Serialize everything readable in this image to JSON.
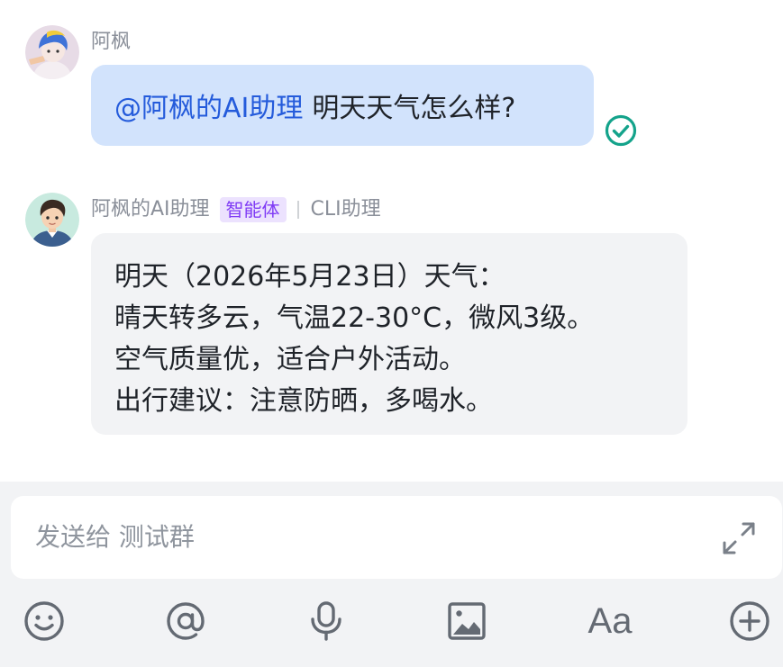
{
  "messages": {
    "user_message": {
      "sender": "阿枫",
      "mention": "@阿枫的AI助理",
      "text": "明天天气怎么样?"
    },
    "bot_message": {
      "sender": "阿枫的AI助理",
      "badge": "智能体",
      "source": "CLI助理",
      "lines": [
        "明天（2026年5月23日）天气：",
        "晴天转多云，气温22-30°C，微风3级。",
        "空气质量优，适合户外活动。",
        "出行建议：注意防晒，多喝水。"
      ]
    }
  },
  "composer": {
    "placeholder": "发送给 测试群",
    "font_button_glyph": "Aa"
  },
  "colors": {
    "user_bubble": "#d2e3fc",
    "mention": "#245bdb",
    "bot_bubble": "#f2f3f5",
    "badge_bg": "#ece2fe",
    "badge_text": "#7f3bf5",
    "read_check": "#14a38b",
    "toolbar_icon": "#646a73"
  },
  "icons": {
    "read_status": "check-circle-icon",
    "expand": "expand-icon",
    "emoji": "smiley-icon",
    "mention": "at-sign-icon",
    "voice": "microphone-icon",
    "image": "image-icon",
    "font": "font-style-icon",
    "more": "plus-circle-icon"
  }
}
